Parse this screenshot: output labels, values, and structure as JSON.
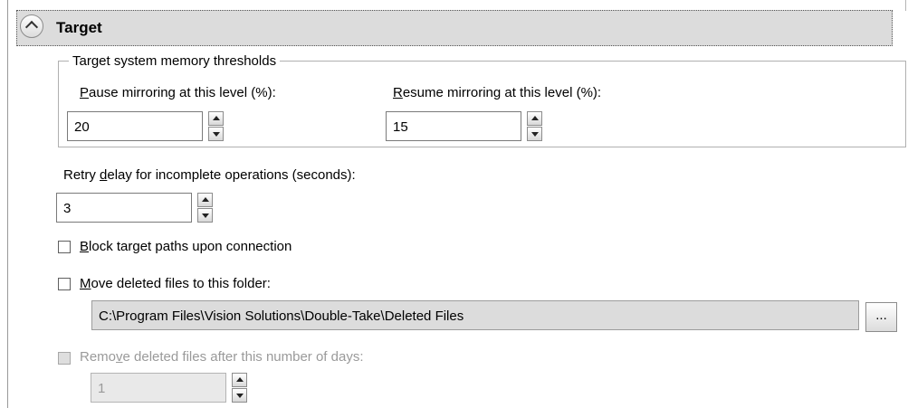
{
  "section": {
    "title": "Target",
    "toggle_icon": "chevron-up-icon"
  },
  "memory_thresholds": {
    "legend": "Target system memory thresholds",
    "pause": {
      "mnemonic": "P",
      "label_rest": "ause mirroring at this level (%):",
      "value": "20"
    },
    "resume": {
      "mnemonic": "R",
      "label_rest": "esume mirroring at this level (%):",
      "value": "15"
    }
  },
  "retry_delay": {
    "label_before": "Retry ",
    "mnemonic": "d",
    "label_after": "elay for incomplete operations (seconds):",
    "value": "3"
  },
  "block_paths": {
    "mnemonic": "B",
    "label_rest": "lock target paths upon connection",
    "checked": false
  },
  "move_deleted": {
    "mnemonic": "M",
    "label_rest": "ove deleted files to this folder:",
    "checked": false,
    "path": "C:\\Program Files\\Vision Solutions\\Double-Take\\Deleted Files",
    "browse_label": "..."
  },
  "remove_deleted": {
    "label_before": "Remo",
    "mnemonic": "v",
    "label_after": "e deleted files after this number of days:",
    "checked": false,
    "enabled": false,
    "value": "1"
  }
}
